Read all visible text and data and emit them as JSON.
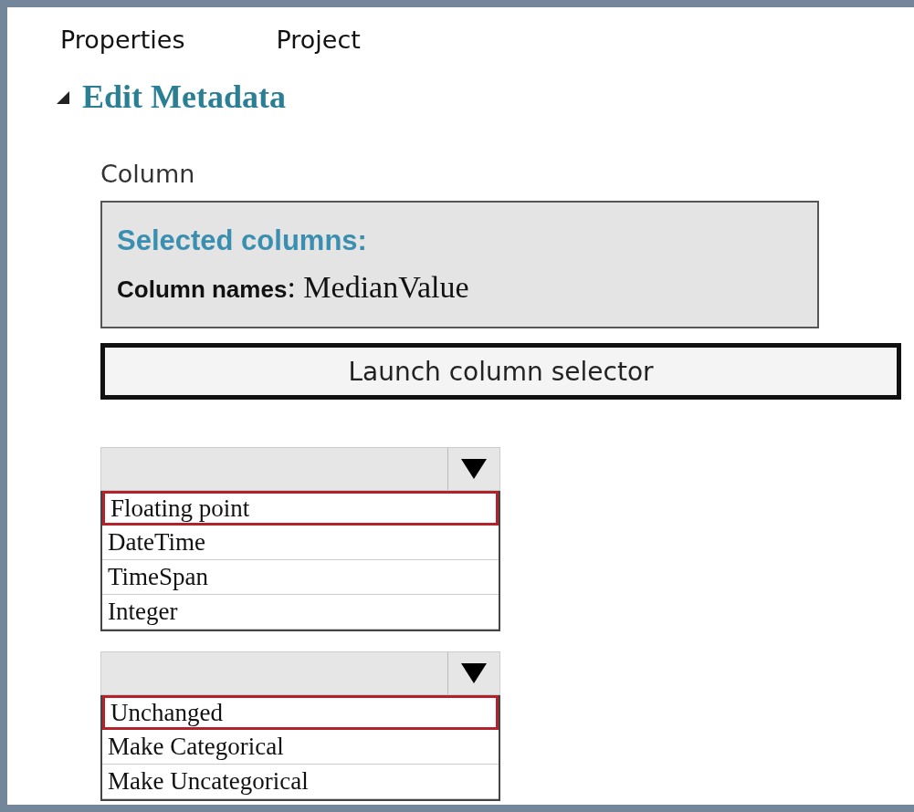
{
  "tabs": [
    {
      "label": "Properties"
    },
    {
      "label": "Project"
    }
  ],
  "section": {
    "title": "Edit Metadata",
    "expanded": true
  },
  "column_label": "Column",
  "selected_columns": {
    "title": "Selected columns:",
    "names": "**Column names**: MedianValue"
  },
  "launch_button": "Launch column selector",
  "dropdowns": [
    {
      "options": [
        {
          "label": "Floating point",
          "selected": true
        },
        {
          "label": "DateTime",
          "selected": false
        },
        {
          "label": "TimeSpan",
          "selected": false
        },
        {
          "label": "Integer",
          "selected": false
        }
      ]
    },
    {
      "options": [
        {
          "label": "Unchanged",
          "selected": true
        },
        {
          "label": "Make Categorical",
          "selected": false
        },
        {
          "label": "Make Uncategorical",
          "selected": false
        }
      ]
    }
  ]
}
